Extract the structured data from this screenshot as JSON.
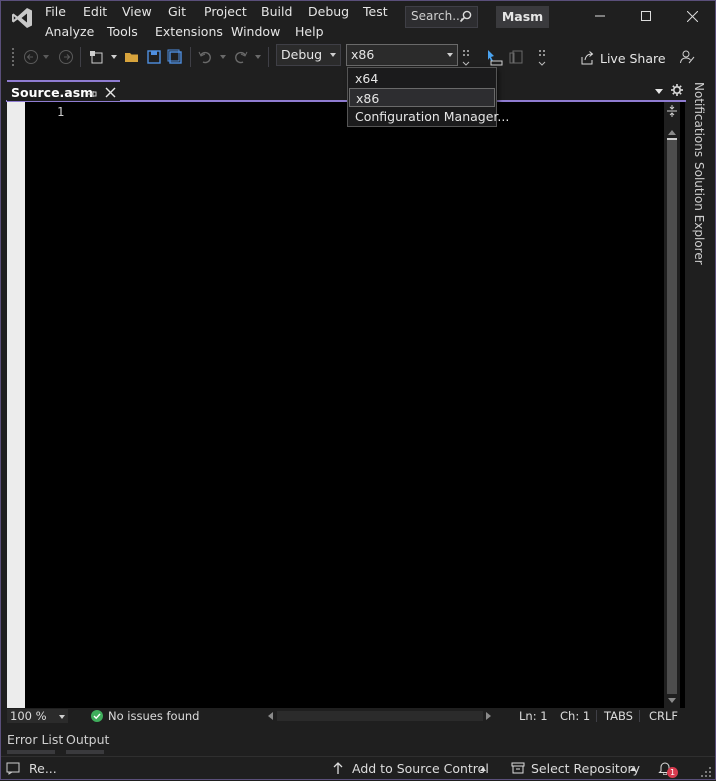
{
  "menu": {
    "row1": [
      "File",
      "Edit",
      "View",
      "Git",
      "Project",
      "Build",
      "Debug",
      "Test"
    ],
    "row2": [
      "Analyze",
      "Tools",
      "Extensions",
      "Window",
      "Help"
    ]
  },
  "search": {
    "label": "Search..."
  },
  "solution_name": "Masm",
  "toolbar": {
    "config_value": "Debug",
    "platform_value": "x86",
    "live_share_label": "Live Share"
  },
  "platform_dropdown": {
    "options": [
      "x64",
      "x86",
      "Configuration Manager..."
    ],
    "selected": "x86"
  },
  "document_tab": {
    "title": "Source.asm"
  },
  "editor": {
    "line_numbers": [
      "1"
    ]
  },
  "side_panels": {
    "notifications": "Notifications",
    "solution_explorer": "Solution Explorer"
  },
  "editor_status": {
    "zoom": "100 %",
    "issues": "No issues found",
    "line": "Ln: 1",
    "col": "Ch: 1",
    "indent": "TABS",
    "line_ending": "CRLF"
  },
  "bottom_tabs": [
    "Error List",
    "Output"
  ],
  "statusbar": {
    "ready": "Re...",
    "add_source_control": "Add to Source Control",
    "select_repository": "Select Repository",
    "notification_count": "1"
  },
  "colors": {
    "accent": "#8f7cd1",
    "editor_bg": "#000000",
    "chrome_bg": "#1f1f1f",
    "issues_ok": "#3fae5c",
    "notification_badge": "#d83b4f"
  }
}
